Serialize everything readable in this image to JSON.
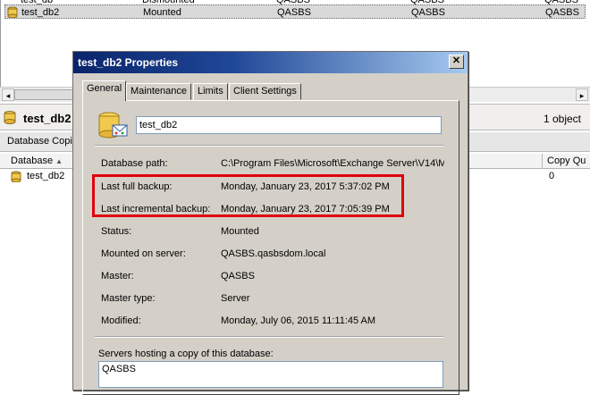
{
  "top_list": {
    "partial_row": {
      "name": "test_db",
      "status": "Dismounted",
      "server": "QASBS",
      "master": "QASBS",
      "col5": "QASBS"
    },
    "selected_row": {
      "name": "test_db2",
      "status": "Mounted",
      "server": "QASBS",
      "master": "QASBS",
      "col5": "QASBS"
    }
  },
  "scrollbar": {
    "left_arrow": "◂",
    "right_arrow": "▸"
  },
  "pane": {
    "title": "test_db2",
    "count": "1 object"
  },
  "copies_tab": "Database Copies",
  "grid": {
    "headers": [
      "Database",
      "Copy Qu"
    ],
    "sort_glyph": "▲",
    "rows": [
      {
        "database": "test_db2",
        "copy_queue": "0"
      }
    ]
  },
  "dialog": {
    "title": "test_db2 Properties",
    "close_glyph": "✕",
    "tabs": [
      "General",
      "Maintenance",
      "Limits",
      "Client Settings"
    ],
    "active_tab": "General",
    "db_name": "test_db2",
    "properties": [
      {
        "label": "Database path:",
        "value": "C:\\Program Files\\Microsoft\\Exchange Server\\V14\\M"
      },
      {
        "label": "Last full backup:",
        "value": "Monday, January 23, 2017 5:37:02 PM"
      },
      {
        "label": "Last incremental backup:",
        "value": "Monday, January 23, 2017 7:05:39 PM"
      },
      {
        "label": "Status:",
        "value": "Mounted"
      },
      {
        "label": "Mounted on server:",
        "value": "QASBS.qasbsdom.local"
      },
      {
        "label": "Master:",
        "value": "QASBS"
      },
      {
        "label": "Master type:",
        "value": "Server"
      },
      {
        "label": "Modified:",
        "value": "Monday, July 06, 2015 11:11:45 AM"
      }
    ],
    "hosting_label": "Servers hosting a copy of this database:",
    "hosting_servers": [
      "QASBS"
    ]
  },
  "colors": {
    "title_bar": "#0a246a",
    "highlight": "#e0000c",
    "dialog_bg": "#d4d0c8"
  }
}
